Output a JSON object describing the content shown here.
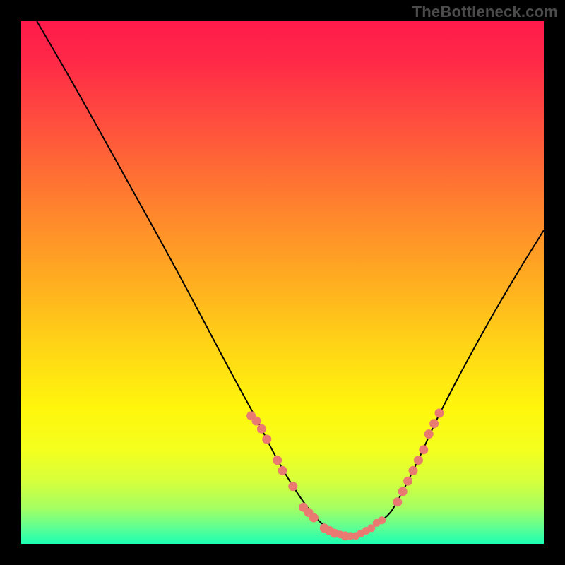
{
  "watermark": "TheBottleneck.com",
  "chart_data": {
    "type": "line",
    "title": "",
    "xlabel": "",
    "ylabel": "",
    "xlim": [
      0,
      100
    ],
    "ylim": [
      0,
      100
    ],
    "grid": false,
    "series": [
      {
        "name": "curve",
        "x": [
          3,
          10,
          20,
          30,
          40,
          45,
          50,
          56,
          60,
          62,
          65,
          70,
          72,
          76,
          80,
          88,
          95,
          100
        ],
        "values": [
          100,
          88,
          70,
          52,
          33,
          24,
          14,
          5,
          2,
          1.5,
          2,
          5,
          8,
          16,
          25,
          40,
          52,
          60
        ]
      },
      {
        "name": "dots-left",
        "x": [
          44,
          45,
          46,
          47,
          49,
          50,
          52,
          54,
          55,
          56,
          58,
          59,
          60,
          62
        ],
        "values": [
          24.5,
          23.5,
          22,
          20,
          16,
          14,
          11,
          7,
          6,
          5,
          3,
          2.5,
          2,
          1.5
        ]
      },
      {
        "name": "dots-right",
        "x": [
          72,
          73,
          74,
          75,
          76,
          77,
          78,
          79,
          80
        ],
        "values": [
          8,
          10,
          12,
          14,
          16,
          18,
          21,
          23,
          25
        ]
      },
      {
        "name": "dots-bottom",
        "x": [
          60,
          61,
          62,
          63,
          64,
          65,
          66,
          67,
          68,
          69
        ],
        "values": [
          2,
          1.8,
          1.5,
          1.5,
          1.5,
          2,
          2.5,
          3,
          4,
          4.5
        ]
      }
    ]
  },
  "colors": {
    "background": "#000000",
    "curve": "#000000",
    "dots": "#e97a72",
    "gradient_top": "#ff1a4b",
    "gradient_mid": "#ffd416",
    "gradient_bottom": "#1bffb2"
  }
}
